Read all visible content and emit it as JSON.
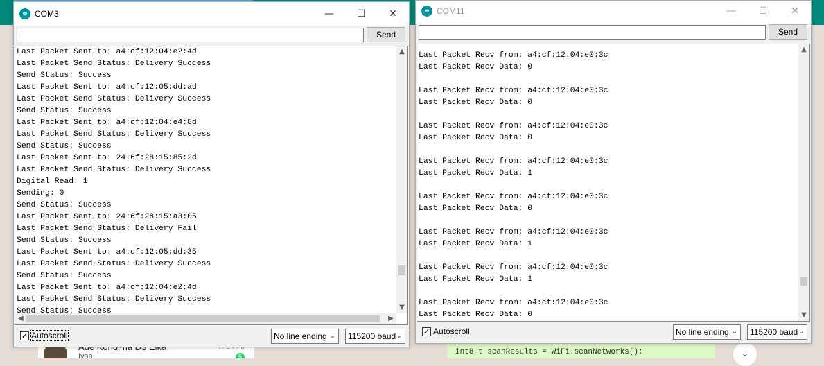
{
  "background": {
    "chat_name": "Ade Kondima D3 Elka",
    "chat_sub": "Iyaa",
    "chat_time": "12:45 PM",
    "chat_badge": "5",
    "code_snippet": "int8_t scanResults = WiFi.scanNetworks();"
  },
  "com3": {
    "title": "COM3",
    "input_value": "",
    "send_label": "Send",
    "lines": [
      "Last Packet Sent to: a4:cf:12:04:e2:4d",
      "Last Packet Send Status: Delivery Success",
      "Send Status: Success",
      "Last Packet Sent to: a4:cf:12:05:dd:ad",
      "Last Packet Send Status: Delivery Success",
      "Send Status: Success",
      "Last Packet Sent to: a4:cf:12:04:e4:8d",
      "Last Packet Send Status: Delivery Success",
      "Send Status: Success",
      "Last Packet Sent to: 24:6f:28:15:85:2d",
      "Last Packet Send Status: Delivery Success",
      "Digital Read: 1",
      "Sending: 0",
      "Send Status: Success",
      "Last Packet Sent to: 24:6f:28:15:a3:05",
      "Last Packet Send Status: Delivery Fail",
      "Send Status: Success",
      "Last Packet Sent to: a4:cf:12:05:dd:35",
      "Last Packet Send Status: Delivery Success",
      "Send Status: Success",
      "Last Packet Sent to: a4:cf:12:04:e2:4d",
      "Last Packet Send Status: Delivery Success",
      "Send Status: Success"
    ],
    "autoscroll_label": "Autoscroll",
    "autoscroll_checked": true,
    "line_ending": "No line ending",
    "baud": "115200 baud"
  },
  "com11": {
    "title": "COM11",
    "input_value": "",
    "send_label": "Send",
    "lines": [
      "Last Packet Recv from: a4:cf:12:04:e0:3c",
      "Last Packet Recv Data: 0",
      "",
      "Last Packet Recv from: a4:cf:12:04:e0:3c",
      "Last Packet Recv Data: 0",
      "",
      "Last Packet Recv from: a4:cf:12:04:e0:3c",
      "Last Packet Recv Data: 0",
      "",
      "Last Packet Recv from: a4:cf:12:04:e0:3c",
      "Last Packet Recv Data: 1",
      "",
      "Last Packet Recv from: a4:cf:12:04:e0:3c",
      "Last Packet Recv Data: 0",
      "",
      "Last Packet Recv from: a4:cf:12:04:e0:3c",
      "Last Packet Recv Data: 1",
      "",
      "Last Packet Recv from: a4:cf:12:04:e0:3c",
      "Last Packet Recv Data: 1",
      "",
      "Last Packet Recv from: a4:cf:12:04:e0:3c",
      "Last Packet Recv Data: 0"
    ],
    "autoscroll_label": "Autoscroll",
    "autoscroll_checked": true,
    "line_ending": "No line ending",
    "baud": "115200 baud"
  },
  "icons": {
    "minimize": "—",
    "maximize": "☐",
    "close": "✕",
    "check": "✓",
    "arrow_up": "▲",
    "arrow_down": "▼",
    "arrow_left": "◀",
    "arrow_right": "▶",
    "chevron": "⌄"
  }
}
